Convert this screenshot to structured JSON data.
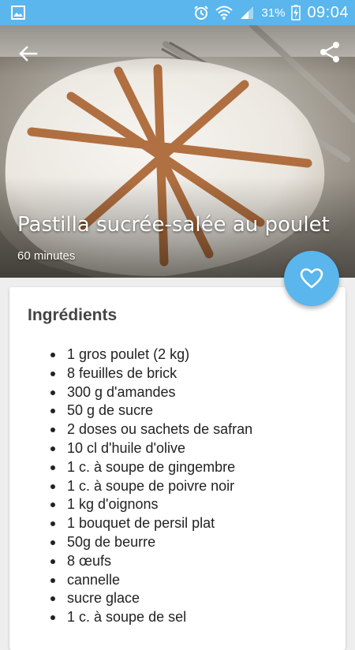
{
  "status_bar": {
    "battery_percent": "31%",
    "time": "09:04",
    "icons": [
      "gallery-icon",
      "alarm-icon",
      "wifi-icon",
      "signal-icon",
      "battery-charging-icon"
    ]
  },
  "header": {
    "back_icon": "arrow-back-icon",
    "share_icon": "share-icon"
  },
  "recipe": {
    "title": "Pastilla sucrée-salée au poulet",
    "time": "60 minutes"
  },
  "favorite": {
    "icon": "heart-outline-icon"
  },
  "ingredients": {
    "heading": "Ingrédients",
    "items": [
      "1 gros poulet (2 kg)",
      "8 feuilles de brick",
      "300 g d'amandes",
      "50 g de sucre",
      "2 doses ou sachets de safran",
      "10 cl d'huile d'olive",
      "1 c. à soupe de gingembre",
      "1 c. à soupe de poivre noir",
      "1 kg d'oignons",
      "1 bouquet de persil plat",
      "50g de beurre",
      "8 œufs",
      "cannelle",
      "sucre glace",
      "1 c. à soupe de sel"
    ]
  },
  "colors": {
    "accent": "#5ab6ec",
    "card": "#ffffff",
    "background": "#eeeeee"
  }
}
